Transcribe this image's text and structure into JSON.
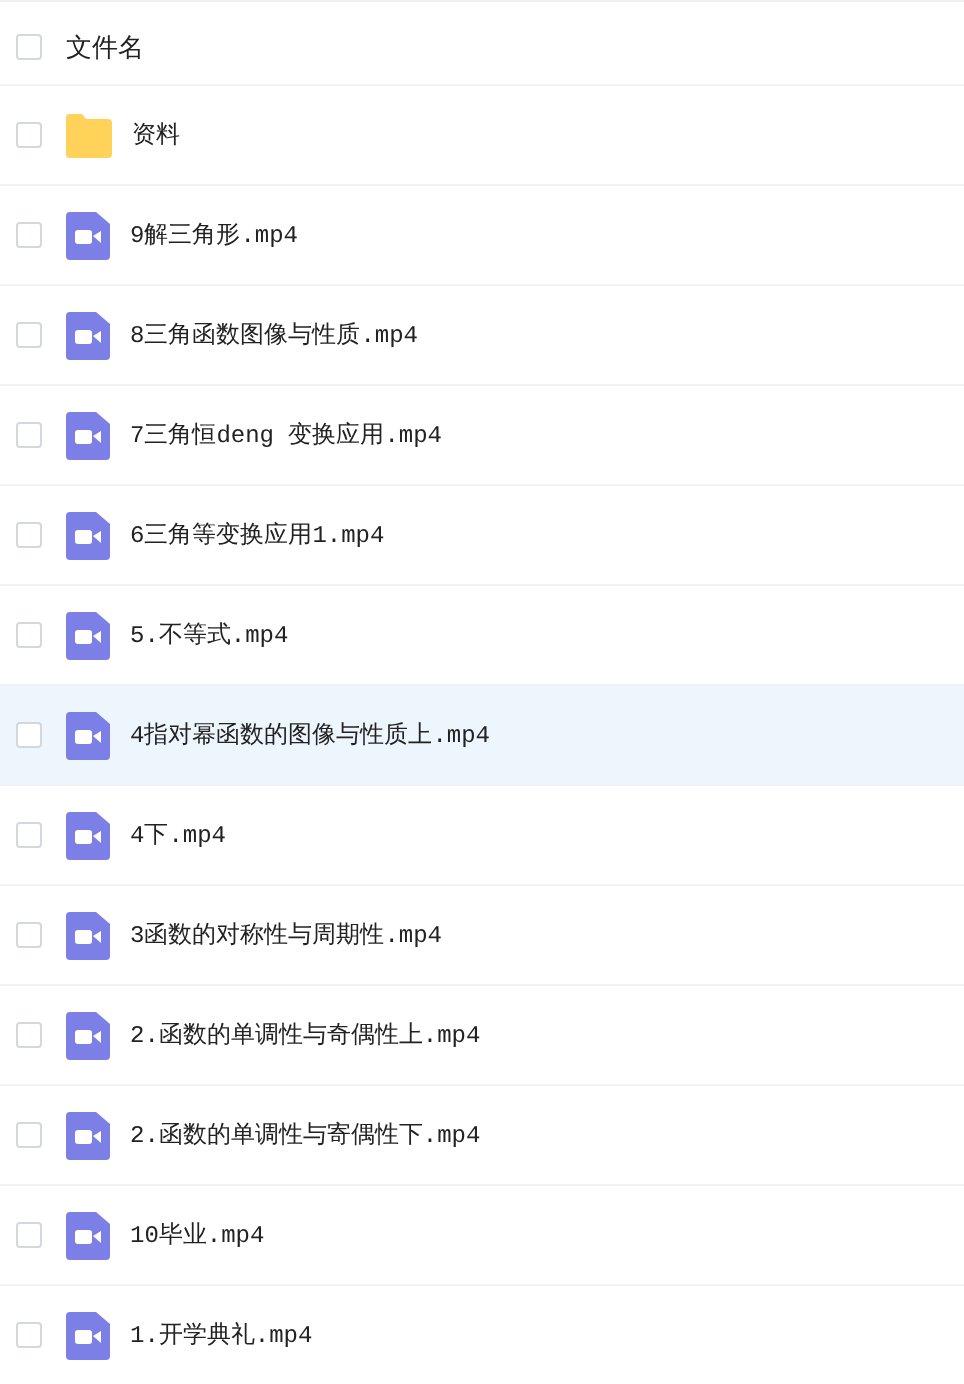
{
  "header": {
    "label": "文件名",
    "checked": false
  },
  "files": [
    {
      "kind": "folder",
      "name": "资料",
      "checked": false,
      "highlighted": false
    },
    {
      "kind": "video",
      "name": "9解三角形.mp4",
      "checked": false,
      "highlighted": false
    },
    {
      "kind": "video",
      "name": "8三角函数图像与性质.mp4",
      "checked": false,
      "highlighted": false
    },
    {
      "kind": "video",
      "name": "7三角恒deng 变换应用.mp4",
      "checked": false,
      "highlighted": false
    },
    {
      "kind": "video",
      "name": "6三角等变换应用1.mp4",
      "checked": false,
      "highlighted": false
    },
    {
      "kind": "video",
      "name": "5.不等式.mp4",
      "checked": false,
      "highlighted": false
    },
    {
      "kind": "video",
      "name": "4指对幂函数的图像与性质上.mp4",
      "checked": false,
      "highlighted": true
    },
    {
      "kind": "video",
      "name": "4下.mp4",
      "checked": false,
      "highlighted": false
    },
    {
      "kind": "video",
      "name": "3函数的对称性与周期性.mp4",
      "checked": false,
      "highlighted": false
    },
    {
      "kind": "video",
      "name": "2.函数的单调性与奇偶性上.mp4",
      "checked": false,
      "highlighted": false
    },
    {
      "kind": "video",
      "name": "2.函数的单调性与寄偶性下.mp4",
      "checked": false,
      "highlighted": false
    },
    {
      "kind": "video",
      "name": "10毕业.mp4",
      "checked": false,
      "highlighted": false
    },
    {
      "kind": "video",
      "name": "1.开学典礼.mp4",
      "checked": false,
      "highlighted": false
    }
  ]
}
